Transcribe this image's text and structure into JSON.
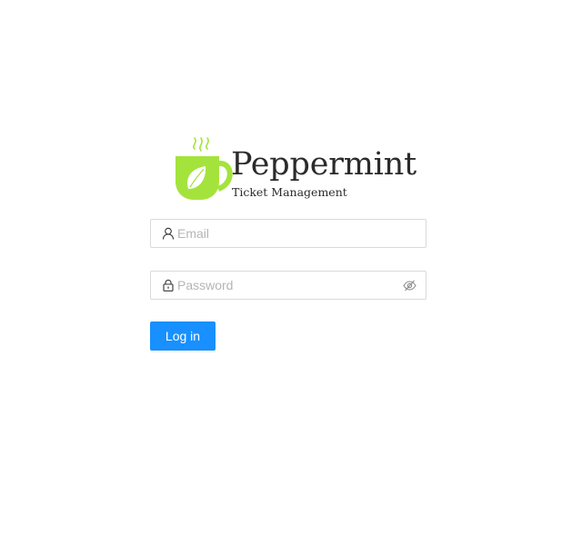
{
  "brand": {
    "name": "Peppermint",
    "tagline": "Ticket Management",
    "logo_icon": "tea-cup-leaf-icon",
    "accent_color": "#a4e33c"
  },
  "login_form": {
    "email": {
      "value": "",
      "placeholder": "Email",
      "icon": "user-icon"
    },
    "password": {
      "value": "",
      "placeholder": "Password",
      "icon": "lock-icon",
      "toggle_icon": "eye-invisible-icon"
    },
    "submit_label": "Log in",
    "submit_color": "#1890ff"
  }
}
